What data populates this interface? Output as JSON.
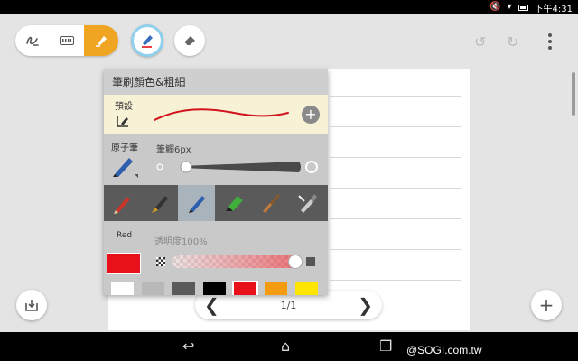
{
  "statusbar": {
    "time": "下午4:31"
  },
  "toolbar": {
    "modes": [
      "handwriting-mode",
      "keyboard-mode",
      "drawing-mode"
    ],
    "active_mode": "drawing-mode"
  },
  "brush_panel": {
    "title": "筆刷顏色&粗細",
    "preset_label": "預設",
    "pen_type_label": "原子筆",
    "stroke_label": "筆觸6px",
    "stroke_px": 6,
    "brushes": [
      "pencil",
      "fountain-pen",
      "ballpoint-pen",
      "marker",
      "paint-brush",
      "airbrush"
    ],
    "active_brush": "ballpoint-pen",
    "color_name": "Red",
    "current_color": "#e8101a",
    "opacity_label": "透明度100%",
    "opacity_percent": 100,
    "swatches": [
      "#ffffff",
      "#b8b8b8",
      "#5a5a5a",
      "#000000",
      "#e8101a",
      "#f39c12",
      "#ffe600"
    ]
  },
  "pager": {
    "page_text": "1/1",
    "prev": "❮",
    "next": "❯"
  },
  "fab": {
    "add": "+"
  },
  "watermark": "@SOGI.com.tw"
}
